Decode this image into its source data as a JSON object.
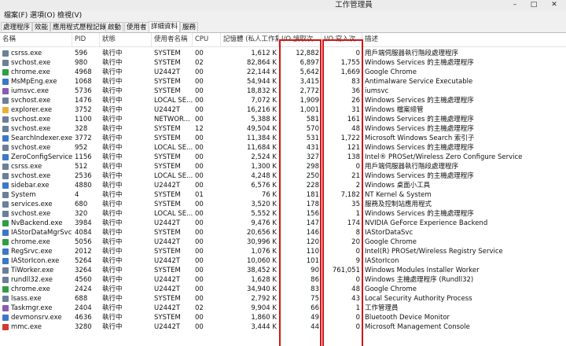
{
  "window": {
    "title": "工作管理員",
    "minimize": "–",
    "maximize": "□",
    "close": "✕"
  },
  "menu": [
    "檔案(F)",
    "選項(O)",
    "檢視(V)"
  ],
  "tabs": [
    "處理程序",
    "效能",
    "應用程式歷程記錄",
    "啟動",
    "使用者",
    "詳細資料",
    "服務"
  ],
  "active_tab": 5,
  "columns": [
    "名稱",
    "PID",
    "狀態",
    "使用者名稱",
    "CPU",
    "記憶體 (私人工作集)",
    "I/O 讀取次...",
    "I/O 寫入次...",
    "描述"
  ],
  "icon_colors": {
    "system": "#6b7f99",
    "chrome": "#2f9e44",
    "explorer": "#e8b13a",
    "app": "#3b78c9",
    "tool": "#8a5bb5",
    "warn": "#cf3b2d"
  },
  "rows": [
    {
      "icon": "system",
      "name": "csrss.exe",
      "pid": "596",
      "status": "執行中",
      "user": "SYSTEM",
      "cpu": "00",
      "mem": "1,612 K",
      "io_read": "12,882",
      "io_write": "0",
      "desc": "用戶端伺服器執行階段處理程序"
    },
    {
      "icon": "system",
      "name": "svchost.exe",
      "pid": "980",
      "status": "執行中",
      "user": "SYSTEM",
      "cpu": "02",
      "mem": "82,864 K",
      "io_read": "6,897",
      "io_write": "1,755",
      "desc": "Windows Services 的主機處理程序"
    },
    {
      "icon": "chrome",
      "name": "chrome.exe",
      "pid": "4968",
      "status": "執行中",
      "user": "U2442T",
      "cpu": "00",
      "mem": "22,144 K",
      "io_read": "5,642",
      "io_write": "1,669",
      "desc": "Google Chrome"
    },
    {
      "icon": "app",
      "name": "MsMpEng.exe",
      "pid": "1068",
      "status": "執行中",
      "user": "SYSTEM",
      "cpu": "00",
      "mem": "54,944 K",
      "io_read": "3,415",
      "io_write": "83",
      "desc": "Antimalware Service Executable"
    },
    {
      "icon": "tool",
      "name": "iumsvc.exe",
      "pid": "5736",
      "status": "執行中",
      "user": "SYSTEM",
      "cpu": "00",
      "mem": "18,832 K",
      "io_read": "2,772",
      "io_write": "36",
      "desc": "iumsvc"
    },
    {
      "icon": "system",
      "name": "svchost.exe",
      "pid": "1476",
      "status": "執行中",
      "user": "LOCAL SE...",
      "cpu": "00",
      "mem": "7,072 K",
      "io_read": "1,909",
      "io_write": "26",
      "desc": "Windows Services 的主機處理程序"
    },
    {
      "icon": "explorer",
      "name": "explorer.exe",
      "pid": "3752",
      "status": "執行中",
      "user": "U2442T",
      "cpu": "00",
      "mem": "16,216 K",
      "io_read": "1,001",
      "io_write": "31",
      "desc": "Windows 檔案總管"
    },
    {
      "icon": "system",
      "name": "svchost.exe",
      "pid": "1100",
      "status": "執行中",
      "user": "NETWOR...",
      "cpu": "00",
      "mem": "5,388 K",
      "io_read": "581",
      "io_write": "161",
      "desc": "Windows Services 的主機處理程序"
    },
    {
      "icon": "system",
      "name": "svchost.exe",
      "pid": "328",
      "status": "執行中",
      "user": "SYSTEM",
      "cpu": "12",
      "mem": "49,504 K",
      "io_read": "570",
      "io_write": "48",
      "desc": "Windows Services 的主機處理程序"
    },
    {
      "icon": "app",
      "name": "SearchIndexer.exe",
      "pid": "3772",
      "status": "執行中",
      "user": "SYSTEM",
      "cpu": "00",
      "mem": "11,384 K",
      "io_read": "531",
      "io_write": "1,722",
      "desc": "Microsoft Windows Search 索引子"
    },
    {
      "icon": "system",
      "name": "svchost.exe",
      "pid": "952",
      "status": "執行中",
      "user": "LOCAL SE...",
      "cpu": "00",
      "mem": "11,684 K",
      "io_read": "431",
      "io_write": "121",
      "desc": "Windows Services 的主機處理程序"
    },
    {
      "icon": "app",
      "name": "ZeroConfigService.e...",
      "pid": "1156",
      "status": "執行中",
      "user": "SYSTEM",
      "cpu": "00",
      "mem": "2,524 K",
      "io_read": "327",
      "io_write": "138",
      "desc": "Intel® PROSet/Wireless Zero Configure Service"
    },
    {
      "icon": "system",
      "name": "csrss.exe",
      "pid": "512",
      "status": "執行中",
      "user": "SYSTEM",
      "cpu": "00",
      "mem": "1,300 K",
      "io_read": "298",
      "io_write": "0",
      "desc": "用戶端伺服器執行階段處理程序"
    },
    {
      "icon": "system",
      "name": "svchost.exe",
      "pid": "2536",
      "status": "執行中",
      "user": "LOCAL SE...",
      "cpu": "00",
      "mem": "4,248 K",
      "io_read": "250",
      "io_write": "21",
      "desc": "Windows Services 的主機處理程序"
    },
    {
      "icon": "app",
      "name": "sidebar.exe",
      "pid": "4880",
      "status": "執行中",
      "user": "U2442T",
      "cpu": "00",
      "mem": "6,576 K",
      "io_read": "228",
      "io_write": "2",
      "desc": "Windows 桌面小工具"
    },
    {
      "icon": "system",
      "name": "System",
      "pid": "4",
      "status": "執行中",
      "user": "SYSTEM",
      "cpu": "01",
      "mem": "76 K",
      "io_read": "181",
      "io_write": "7,182",
      "desc": "NT Kernel & System"
    },
    {
      "icon": "system",
      "name": "services.exe",
      "pid": "680",
      "status": "執行中",
      "user": "SYSTEM",
      "cpu": "00",
      "mem": "3,520 K",
      "io_read": "178",
      "io_write": "35",
      "desc": "服務及控制站應用程式"
    },
    {
      "icon": "system",
      "name": "svchost.exe",
      "pid": "320",
      "status": "執行中",
      "user": "LOCAL SE...",
      "cpu": "00",
      "mem": "5,552 K",
      "io_read": "156",
      "io_write": "1",
      "desc": "Windows Services 的主機處理程序"
    },
    {
      "icon": "chrome",
      "name": "NvBackend.exe",
      "pid": "3984",
      "status": "執行中",
      "user": "U2442T",
      "cpu": "00",
      "mem": "9,476 K",
      "io_read": "147",
      "io_write": "174",
      "desc": "NVIDIA GeForce Experience Backend"
    },
    {
      "icon": "app",
      "name": "IAStorDataMgrSvc.e...",
      "pid": "4084",
      "status": "執行中",
      "user": "SYSTEM",
      "cpu": "00",
      "mem": "20,656 K",
      "io_read": "146",
      "io_write": "8",
      "desc": "IAStorDataSvc"
    },
    {
      "icon": "chrome",
      "name": "chrome.exe",
      "pid": "5056",
      "status": "執行中",
      "user": "U2442T",
      "cpu": "00",
      "mem": "30,996 K",
      "io_read": "120",
      "io_write": "20",
      "desc": "Google Chrome"
    },
    {
      "icon": "app",
      "name": "RegSrvc.exe",
      "pid": "2012",
      "status": "執行中",
      "user": "SYSTEM",
      "cpu": "00",
      "mem": "1,076 K",
      "io_read": "110",
      "io_write": "0",
      "desc": "Intel(R) PROSet/Wireless Registry Service"
    },
    {
      "icon": "app",
      "name": "IAStorIcon.exe",
      "pid": "5264",
      "status": "執行中",
      "user": "U2442T",
      "cpu": "00",
      "mem": "10,060 K",
      "io_read": "101",
      "io_write": "9",
      "desc": "IAStorIcon"
    },
    {
      "icon": "system",
      "name": "TiWorker.exe",
      "pid": "3264",
      "status": "執行中",
      "user": "SYSTEM",
      "cpu": "00",
      "mem": "38,452 K",
      "io_read": "90",
      "io_write": "761,051",
      "desc": "Windows Modules Installer Worker"
    },
    {
      "icon": "system",
      "name": "rundll32.exe",
      "pid": "4560",
      "status": "執行中",
      "user": "U2442T",
      "cpu": "00",
      "mem": "1,628 K",
      "io_read": "86",
      "io_write": "0",
      "desc": "Windows 主機處理程序 (Rundll32)"
    },
    {
      "icon": "chrome",
      "name": "chrome.exe",
      "pid": "2424",
      "status": "執行中",
      "user": "U2442T",
      "cpu": "00",
      "mem": "34,940 K",
      "io_read": "83",
      "io_write": "48",
      "desc": "Google Chrome"
    },
    {
      "icon": "system",
      "name": "lsass.exe",
      "pid": "688",
      "status": "執行中",
      "user": "SYSTEM",
      "cpu": "00",
      "mem": "2,792 K",
      "io_read": "75",
      "io_write": "43",
      "desc": "Local Security Authority Process"
    },
    {
      "icon": "tool",
      "name": "Taskmgr.exe",
      "pid": "2404",
      "status": "執行中",
      "user": "U2442T",
      "cpu": "02",
      "mem": "9,904 K",
      "io_read": "66",
      "io_write": "1",
      "desc": "工作管理員"
    },
    {
      "icon": "app",
      "name": "devmonsrv.exe",
      "pid": "4636",
      "status": "執行中",
      "user": "SYSTEM",
      "cpu": "00",
      "mem": "1,860 K",
      "io_read": "49",
      "io_write": "0",
      "desc": "Bluetooth Device Monitor"
    },
    {
      "icon": "warn",
      "name": "mmc.exe",
      "pid": "3280",
      "status": "執行中",
      "user": "U2442T",
      "cpu": "00",
      "mem": "3,444 K",
      "io_read": "44",
      "io_write": "0",
      "desc": "Microsoft Management Console"
    }
  ]
}
